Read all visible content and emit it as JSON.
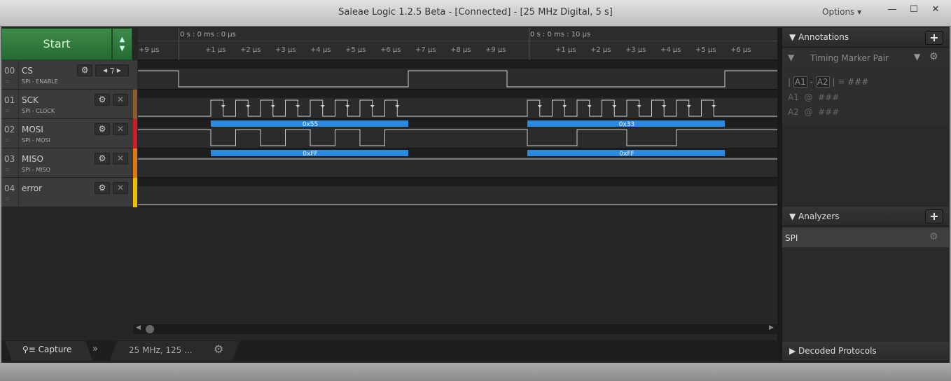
{
  "window": {
    "title": "Saleae Logic 1.2.5 Beta - [Connected] - [25 MHz Digital, 5 s]",
    "options_label": "Options ▾",
    "minimize": "—",
    "maximize": "☐",
    "close": "✕"
  },
  "start_button": {
    "label": "Start"
  },
  "timeline": {
    "markers": [
      "0 s : 0 ms : 0 µs",
      "0 s : 0 ms : 10 µs"
    ],
    "ticks_a": [
      "+9 µs",
      "+1 µs",
      "+2 µs",
      "+3 µs",
      "+4 µs",
      "+5 µs",
      "+6 µs",
      "+7 µs",
      "+8 µs",
      "+9 µs"
    ],
    "ticks_b": [
      "+1 µs",
      "+2 µs",
      "+3 µs",
      "+4 µs",
      "+5 µs",
      "+6 µs"
    ]
  },
  "channels": [
    {
      "num": "00",
      "name": "CS",
      "sub": "SPI - ENABLE",
      "color": "#3a3a3a",
      "trigger": "falling-edge"
    },
    {
      "num": "01",
      "name": "SCK",
      "sub": "SPI - CLOCK",
      "color": "#8b5a2b"
    },
    {
      "num": "02",
      "name": "MOSI",
      "sub": "SPI - MOSI",
      "color": "#c8202a"
    },
    {
      "num": "03",
      "name": "MISO",
      "sub": "SPI - MISO",
      "color": "#e07a10"
    },
    {
      "num": "04",
      "name": "error",
      "sub": "",
      "color": "#e8c000"
    }
  ],
  "signals": {
    "cs_edges_us": [
      0,
      6.56,
      9.38,
      15.6
    ],
    "bursts": [
      {
        "start_us": 0.92,
        "mosi": "0x55",
        "miso": "0xFF",
        "mosi_byte": 85
      },
      {
        "start_us": 9.96,
        "mosi": "0x33",
        "miso": "0xFF",
        "mosi_byte": 51
      }
    ],
    "bit_period_us": 0.71,
    "analyzer_color": "#2a8ae0"
  },
  "annotations": {
    "title": "Annotations",
    "add": "+",
    "marker_type": "Timing Marker Pair",
    "formula": {
      "a1": "A1",
      "a2": "A2",
      "bar": "|",
      "dash": "-",
      "eq": "= ###"
    },
    "rows": [
      {
        "label": "A1",
        "at": "@",
        "value": "###"
      },
      {
        "label": "A2",
        "at": "@",
        "value": "###"
      }
    ]
  },
  "analyzers": {
    "title": "Analyzers",
    "add": "+",
    "items": [
      {
        "name": "SPI"
      }
    ]
  },
  "decoded": {
    "title": "Decoded Protocols"
  },
  "bottom": {
    "capture_tab": "Capture",
    "more": "»",
    "capture_info": "25 MHz, 125 ..."
  }
}
